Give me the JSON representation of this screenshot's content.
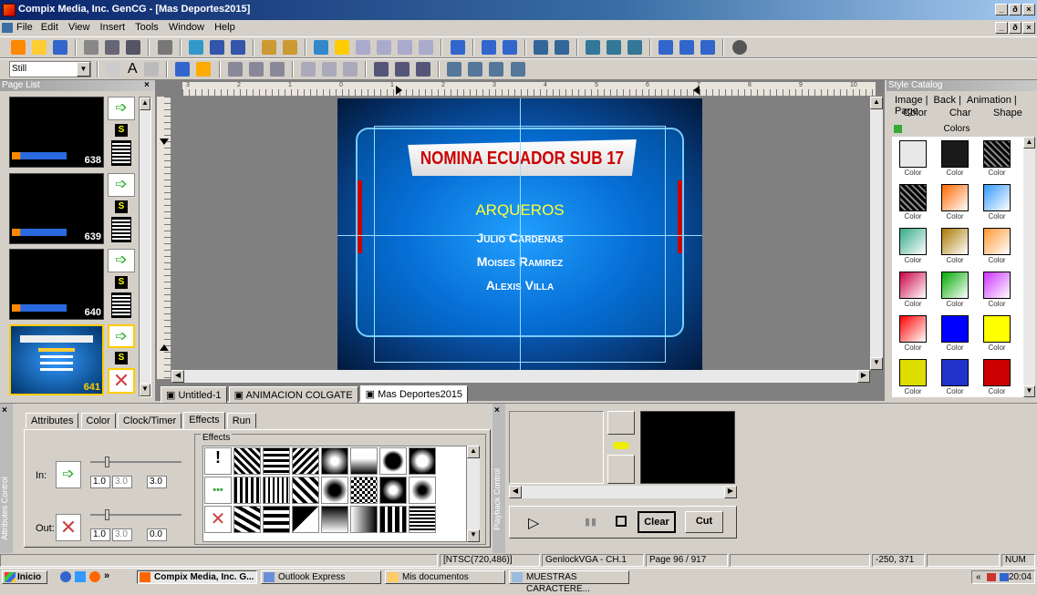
{
  "window": {
    "title": "Compix Media, Inc. GenCG - [Mas Deportes2015]"
  },
  "menu": [
    "File",
    "Edit",
    "View",
    "Insert",
    "Tools",
    "Window",
    "Help"
  ],
  "toolbar2": {
    "style_select": "Still",
    "text_tool": "A"
  },
  "page_list": {
    "title": "Page List",
    "items": [
      {
        "num": "638"
      },
      {
        "num": "639"
      },
      {
        "num": "640"
      },
      {
        "num": "641"
      }
    ],
    "sbtn": "S"
  },
  "canvas": {
    "headline": "NOMINA ECUADOR SUB 17",
    "section": "ARQUEROS",
    "names": [
      "Julio Cardenas",
      "Moises Ramirez",
      "Alexis Villa"
    ],
    "ruler": [
      "3",
      "2",
      "1",
      "0",
      "1",
      "2",
      "3",
      "4",
      "5",
      "6",
      "7",
      "8",
      "9",
      "10"
    ]
  },
  "doc_tabs": [
    "Untitled-1",
    "ANIMACION COLGATE",
    "Mas Deportes2015"
  ],
  "style_catalog": {
    "title": "Style Catalog",
    "tabs_row1": [
      "Image",
      "Back",
      "Animation",
      "Page"
    ],
    "tabs_row2": [
      "Color",
      "Char",
      "Shape"
    ],
    "colors_label": "Colors",
    "swatch_label": "Color",
    "swatches": [
      "#e8e8e8",
      "#1a1a1a",
      "stripe",
      "stripe",
      "#f60",
      "#39f",
      "#3a8",
      "#a70",
      "#f93",
      "#c04",
      "#0a0",
      "#c3f",
      "#f00",
      "#00f",
      "#ff0",
      "#dd0",
      "#23c",
      "#c00"
    ]
  },
  "attributes": {
    "side_label": "Attributes Control",
    "tabs": [
      "Attributes",
      "Color",
      "Clock/Timer",
      "Effects",
      "Run"
    ],
    "effects_label": "Effects",
    "in_label": "In:",
    "out_label": "Out:",
    "in_vals": [
      "1.0",
      "3.0",
      "3.0"
    ],
    "out_vals": [
      "1.0",
      "3.0",
      "0.0"
    ]
  },
  "playback": {
    "side_label": "Playback Control",
    "clear": "Clear",
    "cut": "Cut"
  },
  "status": {
    "format": "[NTSC(720,486)]",
    "genlock": "GenlockVGA - CH.1",
    "page": "Page 96 / 917",
    "coords": "-250, 371",
    "num": "NUM"
  },
  "taskbar": {
    "start": "Inicio",
    "tasks": [
      "Compix Media, Inc. G...",
      "Outlook Express",
      "Mis documentos",
      "MUESTRAS CARACTERE..."
    ],
    "clock": "20:04"
  }
}
